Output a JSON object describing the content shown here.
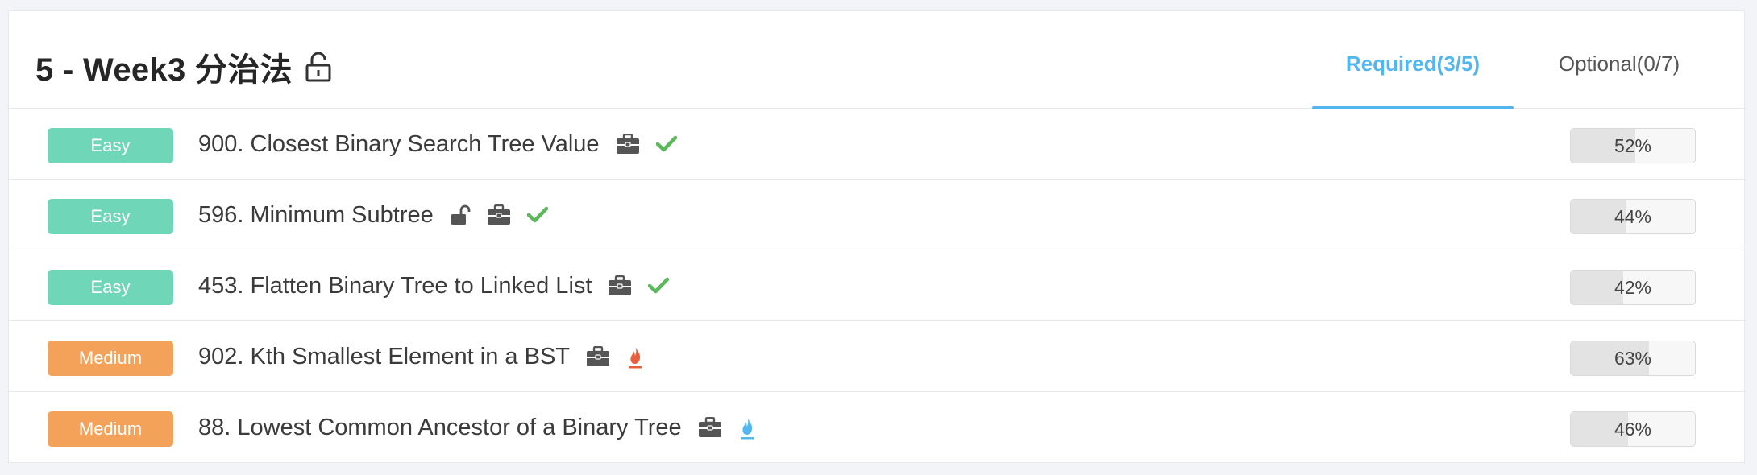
{
  "section": {
    "title": "5 - Week3 分治法",
    "tabs": [
      {
        "label": "Required(3/5)",
        "active": true
      },
      {
        "label": "Optional(0/7)",
        "active": false
      }
    ]
  },
  "colors": {
    "accent": "#52b7ee",
    "easy": "#6fd6b7",
    "medium": "#f4a259",
    "check": "#5cb85c",
    "hot_red": "#e8603c",
    "hot_blue": "#52b7ee"
  },
  "problems": [
    {
      "difficulty": "Easy",
      "title": "900. Closest Binary Search Tree Value",
      "icons": [
        "briefcase-icon",
        "check-icon"
      ],
      "pass_rate_label": "52%",
      "pass_rate": 52
    },
    {
      "difficulty": "Easy",
      "title": "596. Minimum Subtree",
      "icons": [
        "unlock-icon",
        "briefcase-icon",
        "check-icon"
      ],
      "pass_rate_label": "44%",
      "pass_rate": 44
    },
    {
      "difficulty": "Easy",
      "title": "453. Flatten Binary Tree to Linked List",
      "icons": [
        "briefcase-icon",
        "check-icon"
      ],
      "pass_rate_label": "42%",
      "pass_rate": 42
    },
    {
      "difficulty": "Medium",
      "title": "902. Kth Smallest Element in a BST",
      "icons": [
        "briefcase-icon",
        "flame-red-icon"
      ],
      "pass_rate_label": "63%",
      "pass_rate": 63
    },
    {
      "difficulty": "Medium",
      "title": "88. Lowest Common Ancestor of a Binary Tree",
      "icons": [
        "briefcase-icon",
        "flame-blue-icon"
      ],
      "pass_rate_label": "46%",
      "pass_rate": 46
    }
  ]
}
